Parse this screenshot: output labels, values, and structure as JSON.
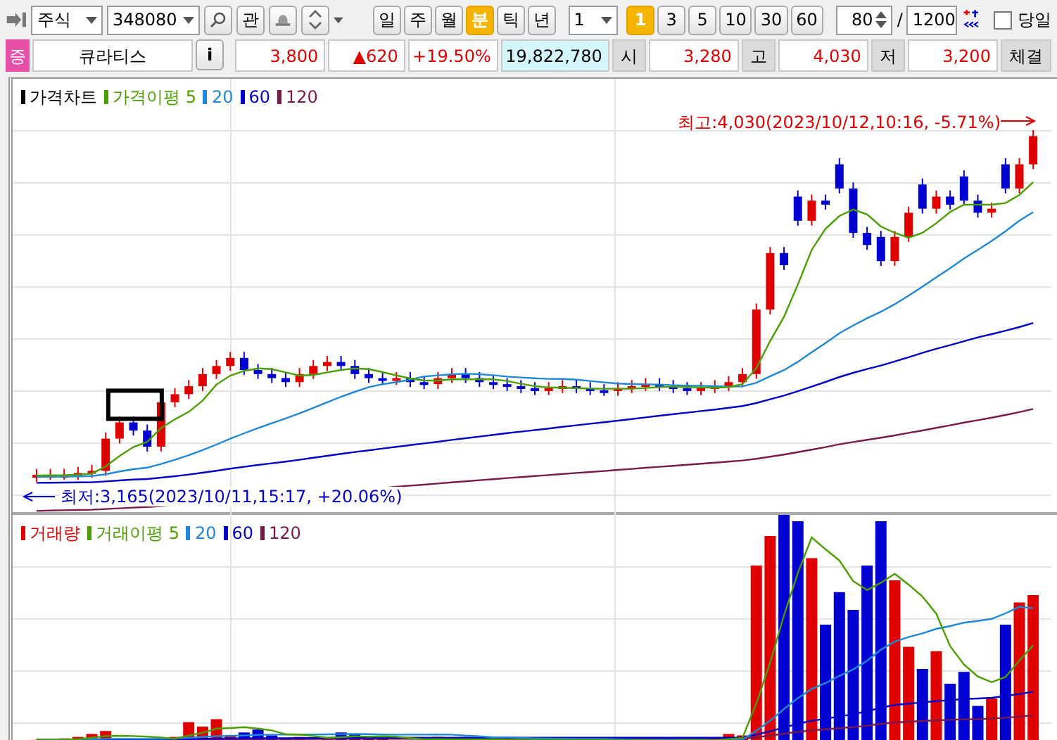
{
  "toolbar": {
    "market_select": "주식",
    "code_field": "348080",
    "watch_button": "관",
    "period_tabs": [
      {
        "label": "일",
        "selected": false
      },
      {
        "label": "주",
        "selected": false
      },
      {
        "label": "월",
        "selected": false
      },
      {
        "label": "분",
        "selected": true
      },
      {
        "label": "틱",
        "selected": false
      },
      {
        "label": "년",
        "selected": false
      }
    ],
    "interval_select": "1",
    "interval_tabs": [
      {
        "label": "1",
        "selected": true
      },
      {
        "label": "3",
        "selected": false
      },
      {
        "label": "5",
        "selected": false
      },
      {
        "label": "10",
        "selected": false
      },
      {
        "label": "30",
        "selected": false
      },
      {
        "label": "60",
        "selected": false
      }
    ],
    "count_field": "80",
    "separator": "/",
    "total_field": "1200",
    "today_checkbox": {
      "label": "당일",
      "checked": false
    }
  },
  "quote": {
    "badge": "증",
    "name": "큐라티스",
    "info_button": "i",
    "price": "3,800",
    "change": "▲620",
    "rate": "+19.50%",
    "volume": "19,822,780",
    "fields": [
      {
        "label": "시",
        "value": "3,280"
      },
      {
        "label": "고",
        "value": "4,030"
      },
      {
        "label": "저",
        "value": "3,200"
      }
    ],
    "trailing_label": "체결"
  },
  "price_panel": {
    "legend": [
      {
        "label": "가격차트",
        "color": "#000000"
      },
      {
        "label": "가격이평 5",
        "color": "#4a9e00"
      },
      {
        "label": "20",
        "color": "#1e88d8"
      },
      {
        "label": "60",
        "color": "#0000c8"
      },
      {
        "label": "120",
        "color": "#7a1a4a"
      }
    ],
    "high_annotation": "최고:4,030(2023/10/12,10:16, -5.71%)",
    "low_annotation": "최저:3,165(2023/10/11,15:17, +20.06%)"
  },
  "volume_panel": {
    "legend": [
      {
        "label": "거래량",
        "color": "#e00000"
      },
      {
        "label": "거래이평 5",
        "color": "#4a9e00"
      },
      {
        "label": "20",
        "color": "#1e88d8"
      },
      {
        "label": "60",
        "color": "#0000c8"
      },
      {
        "label": "120",
        "color": "#7a1a4a"
      }
    ]
  }
}
